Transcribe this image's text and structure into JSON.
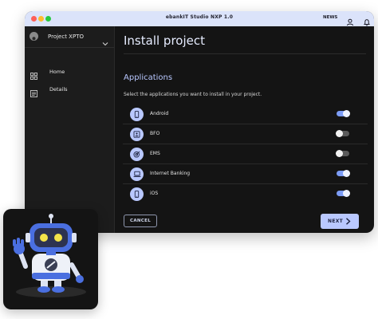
{
  "window": {
    "title": "ebankIT Studio NXP 1.0",
    "news_label": "NEWS"
  },
  "sidebar": {
    "project_name": "Project XPTO",
    "items": [
      {
        "label": "Home",
        "icon": "grid-icon"
      },
      {
        "label": "Details",
        "icon": "document-list-icon"
      }
    ]
  },
  "main": {
    "page_title": "Install project",
    "section_title": "Applications",
    "section_desc": "Select the applications you want to install in your project.",
    "apps": [
      {
        "label": "Android",
        "icon": "phone-icon",
        "enabled": true
      },
      {
        "label": "BFO",
        "icon": "id-card-icon",
        "enabled": false
      },
      {
        "label": "EMS",
        "icon": "target-icon",
        "enabled": false
      },
      {
        "label": "Internet Banking",
        "icon": "laptop-icon",
        "enabled": true
      },
      {
        "label": "iOS",
        "icon": "phone-icon",
        "enabled": true
      }
    ],
    "cancel_label": "CANCEL",
    "next_label": "NEXT"
  },
  "colors": {
    "accent": "#b9c8ff",
    "toggle_on": "#7c9cf5",
    "toggle_off": "#5a5a5a",
    "window_bg": "#141414",
    "titlebar_bg": "#dbe3fa"
  }
}
